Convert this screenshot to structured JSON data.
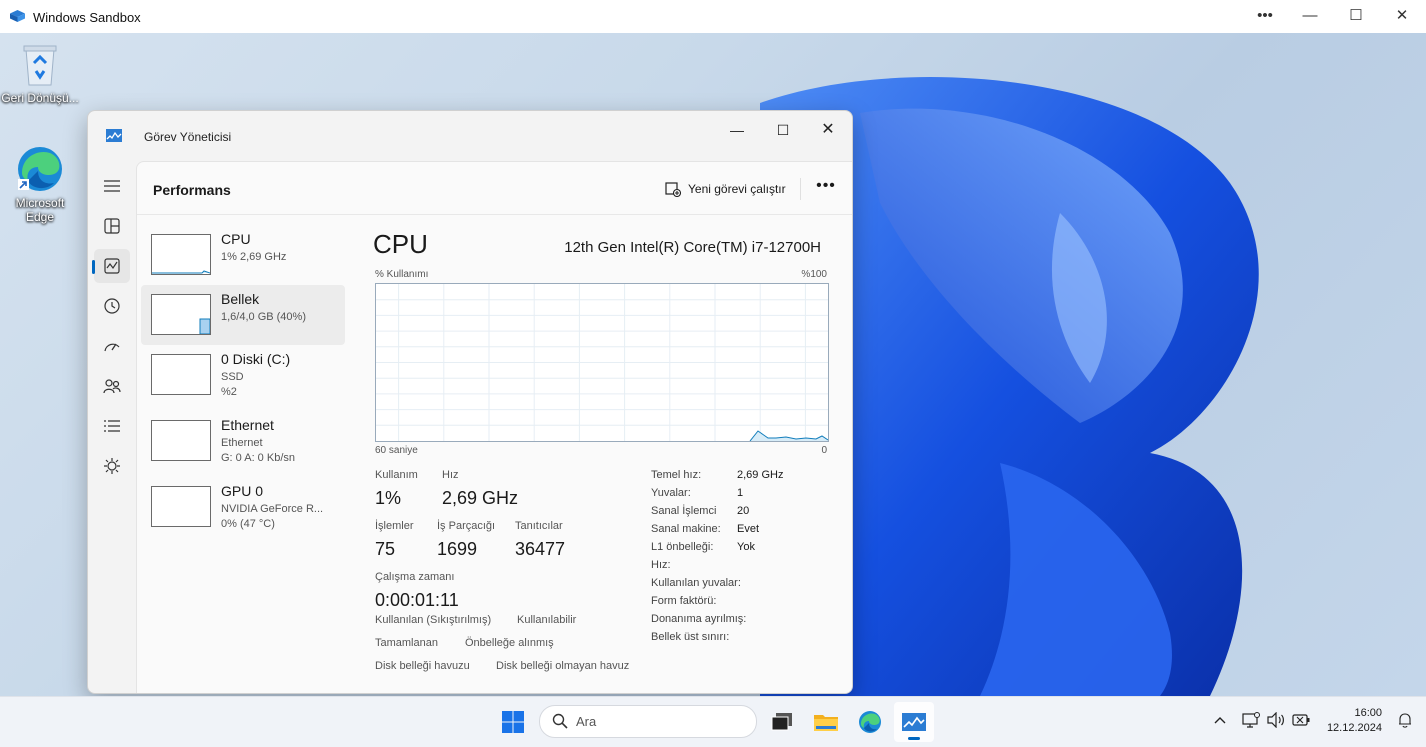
{
  "window": {
    "title": "Windows Sandbox",
    "controls": {
      "more": "•••",
      "minimize": "—",
      "maximize": "☐",
      "close": "✕"
    }
  },
  "desktop": {
    "icons": [
      {
        "label": "Geri Dönüşü...",
        "icon": "recycle-bin-icon"
      },
      {
        "label": "Microsoft Edge",
        "icon": "edge-icon"
      }
    ]
  },
  "task_manager": {
    "title": "Görev Yöneticisi",
    "page_title": "Performans",
    "run_task_label": "Yeni görevi çalıştır",
    "more_label": "•••",
    "nav": [
      "hamburger-icon",
      "processes-icon",
      "performance-icon",
      "app-history-icon",
      "startup-apps-icon",
      "users-icon",
      "details-icon",
      "services-icon"
    ],
    "perf_items": [
      {
        "name": "CPU",
        "sub1": "1% 2,69 GHz"
      },
      {
        "name": "Bellek",
        "sub1": "1,6/4,0 GB (40%)"
      },
      {
        "name": "0 Diski (C:)",
        "sub1": "SSD",
        "sub2": "%2"
      },
      {
        "name": "Ethernet",
        "sub1": "Ethernet",
        "sub2": "G: 0 A: 0 Kb/sn"
      },
      {
        "name": "GPU 0",
        "sub1": "NVIDIA GeForce R...",
        "sub2": "0% (47 °C)"
      }
    ],
    "detail": {
      "title": "CPU",
      "model": "12th Gen Intel(R) Core(TM) i7-12700H",
      "graph_top_left": "% Kullanımı",
      "graph_top_right": "%100",
      "graph_bottom_left": "60 saniye",
      "graph_bottom_right": "0",
      "stats": {
        "usage_label": "Kullanım",
        "usage_value": "1%",
        "speed_label": "Hız",
        "speed_value": "2,69 GHz",
        "processes_label": "İşlemler",
        "processes_value": "75",
        "threads_label": "İş Parçacığı",
        "threads_value": "1699",
        "handles_label": "Tanıtıcılar",
        "handles_value": "36477",
        "uptime_label": "Çalışma zamanı",
        "uptime_value": "0:00:01:11"
      },
      "specs": [
        {
          "k": "Temel hız:",
          "v": "2,69 GHz"
        },
        {
          "k": "Yuvalar:",
          "v": "1"
        },
        {
          "k": "Sanal İşlemci",
          "v": "20"
        },
        {
          "k": "Sanal makine:",
          "v": "Evet"
        },
        {
          "k": "L1 önbelleği:",
          "v": "Yok"
        },
        {
          "k": "Hız:",
          "v": ""
        },
        {
          "k": "Kullanılan yuvalar:",
          "v": ""
        },
        {
          "k": "Form faktörü:",
          "v": ""
        },
        {
          "k": "Donanıma ayrılmış:",
          "v": ""
        },
        {
          "k": "Bellek üst sınırı:",
          "v": ""
        }
      ],
      "mem_labels": {
        "in_use": "Kullanılan (Sıkıştırılmış)",
        "available": "Kullanılabilir",
        "committed": "Tamamlanan",
        "cached": "Önbelleğe alınmış",
        "paged_pool": "Disk belleği havuzu",
        "non_paged_pool": "Disk belleği olmayan havuz"
      }
    }
  },
  "taskbar": {
    "search_placeholder": "Ara",
    "apps": [
      "start-icon",
      "task-view-icon",
      "file-explorer-icon",
      "edge-icon",
      "task-manager-icon"
    ],
    "time": "16:00",
    "date": "12.12.2024"
  },
  "colors": {
    "accent": "#0067c0",
    "cpu_graph": "#117dbb",
    "memory_graph": "#8b12ae"
  }
}
